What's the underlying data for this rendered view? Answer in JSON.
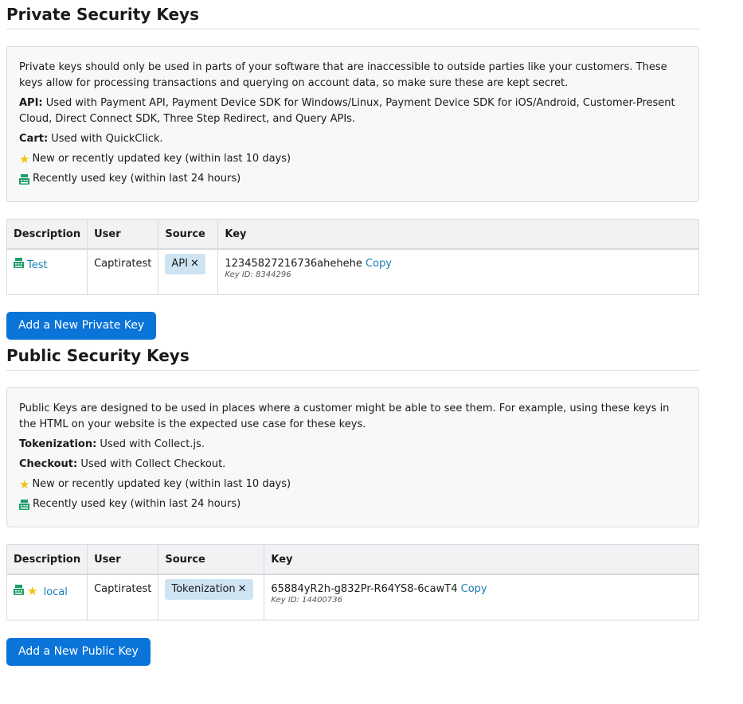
{
  "private": {
    "title": "Private Security Keys",
    "intro": "Private keys should only be used in parts of your software that are inaccessible to outside parties like your customers. These keys allow for processing transactions and querying on account data, so make sure these are kept secret.",
    "api_label": "API:",
    "api_text": " Used with Payment API, Payment Device SDK for Windows/Linux, Payment Device SDK for iOS/Android, Customer-Present Cloud, Direct Connect SDK, Three Step Redirect, and Query APIs.",
    "cart_label": "Cart:",
    "cart_text": " Used with QuickClick.",
    "legend_new": "New or recently updated key (within last 10 days)",
    "legend_used": "Recently used key (within last 24 hours)",
    "headers": [
      "Description",
      "User",
      "Source",
      "Key"
    ],
    "rows": [
      {
        "description": "Test",
        "user": "Captiratest",
        "source": "API",
        "key": "12345827216736ahehehe",
        "copy": "Copy",
        "key_id": "Key ID: 8344296"
      }
    ],
    "add_button": "Add a New Private Key"
  },
  "public": {
    "title": "Public Security Keys",
    "intro": "Public Keys are designed to be used in places where a customer might be able to see them. For example, using these keys in the HTML on your website is the expected use case for these keys.",
    "tokenization_label": "Tokenization:",
    "tokenization_text": " Used with Collect.js.",
    "checkout_label": "Checkout:",
    "checkout_text": " Used with Collect Checkout.",
    "legend_new": "New or recently updated key (within last 10 days)",
    "legend_used": "Recently used key (within last 24 hours)",
    "headers": [
      "Description",
      "User",
      "Source",
      "Key"
    ],
    "rows": [
      {
        "description": "local",
        "user": "Captiratest",
        "source": "Tokenization",
        "key": "65884yR2h-g832Pr-R64YS8-6cawT4",
        "copy": "Copy",
        "key_id": "Key ID: 14400736"
      }
    ],
    "add_button": "Add a New Public Key"
  },
  "colors": {
    "accent": "#0a74d8",
    "link": "#1a7fb3",
    "badge": "#cfe4f3",
    "star": "#f4c20d",
    "used_icon": "#1e9c6a"
  },
  "icons": {
    "star": "star-icon",
    "recently_used": "register-icon",
    "remove": "close-icon"
  }
}
